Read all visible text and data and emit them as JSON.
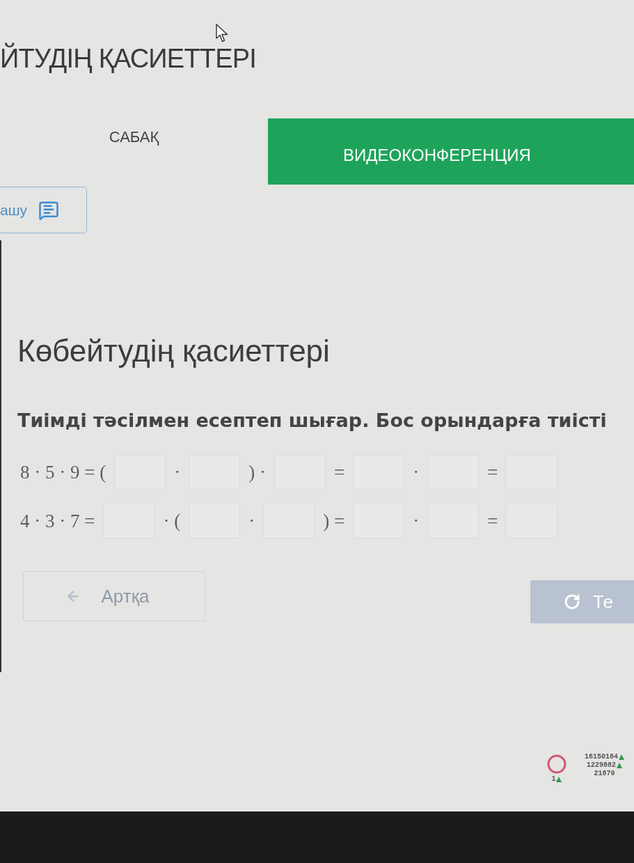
{
  "header": {
    "title": "ЙТУДІҢ ҚАСИЕТТЕРІ"
  },
  "tabs": [
    {
      "label": "САБАҚ",
      "selected": false
    },
    {
      "label": "ВИДЕОКОНФЕРЕНЦИЯ",
      "selected": true
    }
  ],
  "discuss_button": {
    "label": "ашу"
  },
  "lesson": {
    "title": "Көбейтудің қасиеттері",
    "instruction": "Тиімді тәсілмен есептеп шығар. Бос орындарға тиісті",
    "equations": [
      {
        "parts": [
          {
            "kind": "text",
            "text": "8 · 5 · 9 = ("
          },
          {
            "kind": "blank"
          },
          {
            "kind": "text",
            "text": "·"
          },
          {
            "kind": "blank"
          },
          {
            "kind": "text",
            "text": ") ·"
          },
          {
            "kind": "blank"
          },
          {
            "kind": "text",
            "text": "="
          },
          {
            "kind": "blank"
          },
          {
            "kind": "text",
            "text": "·"
          },
          {
            "kind": "blank"
          },
          {
            "kind": "text",
            "text": "="
          },
          {
            "kind": "blank"
          }
        ]
      },
      {
        "parts": [
          {
            "kind": "text",
            "text": "4 · 3 · 7 ="
          },
          {
            "kind": "blank"
          },
          {
            "kind": "text",
            "text": "· ("
          },
          {
            "kind": "blank"
          },
          {
            "kind": "text",
            "text": "·"
          },
          {
            "kind": "blank"
          },
          {
            "kind": "text",
            "text": ") ="
          },
          {
            "kind": "blank"
          },
          {
            "kind": "text",
            "text": "·"
          },
          {
            "kind": "blank"
          },
          {
            "kind": "text",
            "text": "="
          },
          {
            "kind": "blank"
          }
        ]
      }
    ]
  },
  "nav": {
    "back": {
      "label": "Артқа",
      "disabled": true
    },
    "next": {
      "label": "Те",
      "disabled": true
    }
  },
  "stats": {
    "ring": {
      "value": "1",
      "up": true
    },
    "counters": [
      {
        "value": "16150164",
        "up": true
      },
      {
        "value": "1229882",
        "up": true
      },
      {
        "value": "21870",
        "up": false
      }
    ]
  }
}
